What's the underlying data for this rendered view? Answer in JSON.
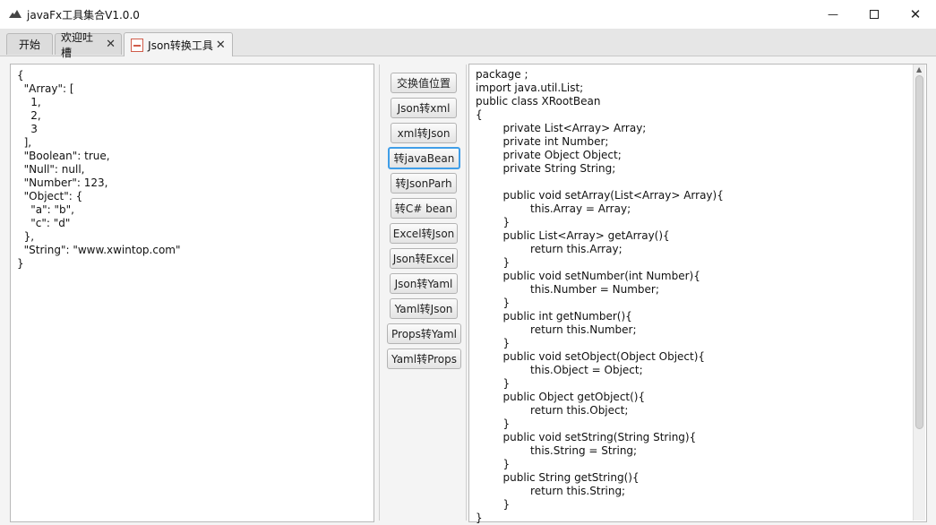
{
  "window": {
    "title": "javaFx工具集合V1.0.0",
    "minimize_symbol": "—",
    "maximize_symbol": "☐",
    "close_symbol": "✕"
  },
  "tabs": [
    {
      "label": "开始",
      "closable": false
    },
    {
      "label": "欢迎吐槽",
      "closable": true
    },
    {
      "label": "Json转换工具",
      "closable": true,
      "active": true,
      "icon": "json-file-icon"
    }
  ],
  "tab_close_symbol": "✕",
  "input_editor": {
    "text": "{\n  \"Array\": [\n    1,\n    2,\n    3\n  ],\n  \"Boolean\": true,\n  \"Null\": null,\n  \"Number\": 123,\n  \"Object\": {\n    \"a\": \"b\",\n    \"c\": \"d\"\n  },\n  \"String\": \"www.xwintop.com\"\n}"
  },
  "buttons": [
    {
      "label": "交换值位置"
    },
    {
      "label": "Json转xml"
    },
    {
      "label": "xml转Json"
    },
    {
      "label": "转javaBean",
      "focused": true
    },
    {
      "label": "转JsonParh"
    },
    {
      "label": "转C# bean"
    },
    {
      "label": "Excel转Json"
    },
    {
      "label": "Json转Excel"
    },
    {
      "label": "Json转Yaml"
    },
    {
      "label": "Yaml转Json"
    },
    {
      "label": "Props转Yaml"
    },
    {
      "label": "Yaml转Props"
    }
  ],
  "output_editor": {
    "text": "package ;\nimport java.util.List;\npublic class XRootBean\n{\n        private List<Array> Array;\n        private int Number;\n        private Object Object;\n        private String String;\n\n        public void setArray(List<Array> Array){\n                this.Array = Array;\n        }\n        public List<Array> getArray(){\n                return this.Array;\n        }\n        public void setNumber(int Number){\n                this.Number = Number;\n        }\n        public int getNumber(){\n                return this.Number;\n        }\n        public void setObject(Object Object){\n                this.Object = Object;\n        }\n        public Object getObject(){\n                return this.Object;\n        }\n        public void setString(String String){\n                this.String = String;\n        }\n        public String getString(){\n                return this.String;\n        }\n}"
  },
  "colors": {
    "focus_ring": "#3f9ee8",
    "tab_icon_red": "#d05c4a"
  }
}
